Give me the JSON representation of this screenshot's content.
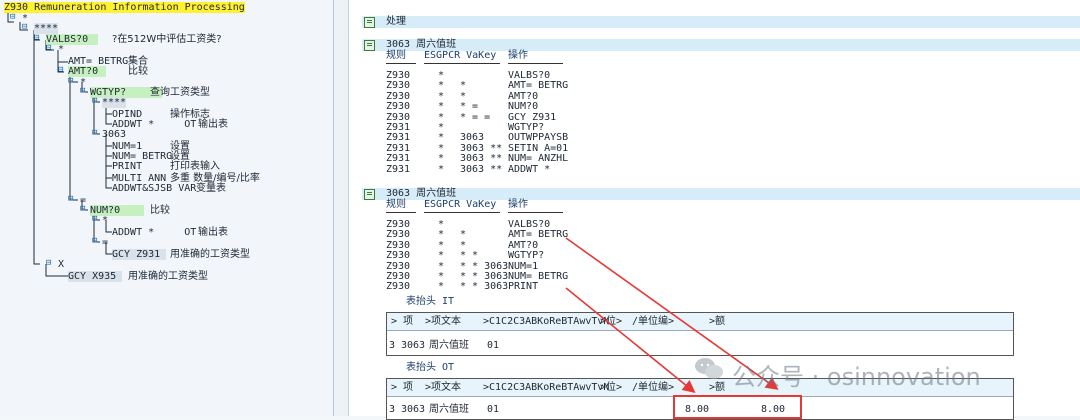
{
  "tree": {
    "root": "Z930 Remuneration Information Processing",
    "nodes": [
      {
        "text": "*"
      },
      {
        "text": "****"
      },
      {
        "text": "VALBS?0",
        "desc": "?在512W中评估工资类?"
      },
      {
        "text": "*"
      },
      {
        "text": "AMT= BETRG",
        "desc": "集合"
      },
      {
        "text": "AMT?0",
        "desc": "比较"
      },
      {
        "text": "*"
      },
      {
        "text": "WGTYP?",
        "desc": "查询工资类型"
      },
      {
        "text": "****"
      },
      {
        "text": "OPIND",
        "desc": "操作标志"
      },
      {
        "text": "ADDWT *     OT",
        "desc": "输出表"
      },
      {
        "text": "3063"
      },
      {
        "text": "NUM=1",
        "desc": "设置"
      },
      {
        "text": "NUM= BETRG",
        "desc": "设置"
      },
      {
        "text": "PRINT",
        "desc": "打印表输入"
      },
      {
        "text": "MULTI ANN",
        "desc": "多重 数量/编号/比率"
      },
      {
        "text": "ADDWT&SJSB VAR",
        "desc": "变量表"
      },
      {
        "text": "="
      },
      {
        "text": "NUM?0",
        "desc": "比较"
      },
      {
        "text": "*"
      },
      {
        "text": "ADDWT *     OT",
        "desc": "输出表"
      },
      {
        "text": "="
      },
      {
        "text": "GCY Z931",
        "desc": "用准确的工资类型"
      },
      {
        "text": "X"
      },
      {
        "text": "GCY X935",
        "desc": "用准确的工资类型"
      }
    ]
  },
  "right": {
    "top_title": "处理",
    "sections": [
      {
        "title": "3063 周六值班",
        "headers": [
          "规则",
          "ESGPCR VaKey",
          "操作"
        ],
        "rows": [
          [
            "Z930",
            "*",
            "",
            "VALBS?0"
          ],
          [
            "Z930",
            "*",
            "*",
            "AMT= BETRG"
          ],
          [
            "Z930",
            "*",
            "*",
            "AMT?0"
          ],
          [
            "Z930",
            "*",
            "* =",
            "NUM?0"
          ],
          [
            "Z930",
            "*",
            "* = =",
            "GCY Z931"
          ],
          [
            "Z931",
            "*",
            "",
            "WGTYP?"
          ],
          [
            "Z931",
            "*",
            "3063",
            "OUTWPPAYSB"
          ],
          [
            "Z931",
            "*",
            "3063 **",
            "SETIN A=01"
          ],
          [
            "Z931",
            "*",
            "3063 **",
            "NUM= ANZHL"
          ],
          [
            "Z931",
            "*",
            "3063 **",
            "ADDWT *"
          ]
        ]
      },
      {
        "title": "3063 周六值班",
        "headers": [
          "规则",
          "ESGPCR VaKey",
          "操作"
        ],
        "rows": [
          [
            "Z930",
            "*",
            "",
            "VALBS?0"
          ],
          [
            "Z930",
            "*",
            "*",
            "AMT= BETRG"
          ],
          [
            "Z930",
            "*",
            "*",
            "AMT?0"
          ],
          [
            "Z930",
            "*",
            "* *",
            "WGTYP?"
          ],
          [
            "Z930",
            "*",
            "* * 3063",
            "NUM=1"
          ],
          [
            "Z930",
            "*",
            "* * 3063",
            "NUM= BETRG"
          ],
          [
            "Z930",
            "*",
            "* * 3063",
            "PRINT"
          ]
        ]
      }
    ],
    "table_it": {
      "label": "表抬头 IT",
      "headers": [
        "> 项",
        ">项文本",
        ">C1C2C3ABKoReBTAwvTvN",
        ">位>",
        "/单位编>",
        ">额"
      ],
      "row": [
        "3",
        "3063",
        "周六值班",
        "01",
        "",
        ""
      ]
    },
    "table_ot": {
      "label": "表抬头 OT",
      "headers": [
        "> 项",
        ">项文本",
        ">C1C2C3ABKoReBTAwvTvN",
        ">位>",
        "/单位编>",
        ">额"
      ],
      "row": [
        "3",
        "3063",
        "周六值班",
        "01",
        "8.00",
        "8.00"
      ]
    }
  },
  "watermark": "公众号 · osinnovation",
  "colors": {
    "accent_red": "#e53935",
    "highlight_yellow": "#fff12e",
    "highlight_green": "#c7f0c0",
    "section_bar": "#d6ecf8"
  }
}
